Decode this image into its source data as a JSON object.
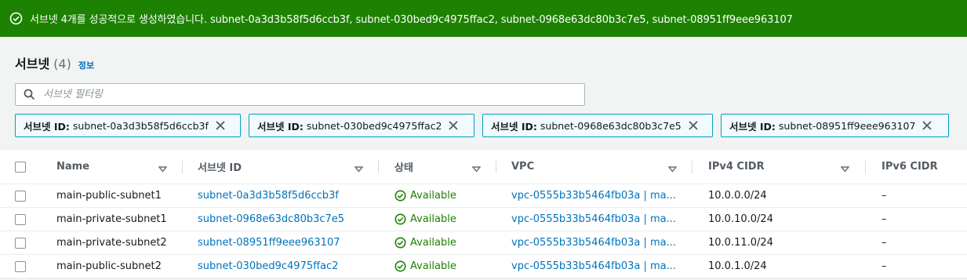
{
  "flash": {
    "message": "서브넷 4개를 성공적으로 생성하였습니다. subnet-0a3d3b58f5d6ccb3f, subnet-030bed9c4975ffac2, subnet-0968e63dc80b3c7e5, subnet-08951ff9eee963107",
    "color": "#1d8102"
  },
  "header": {
    "title": "서브넷",
    "count": "(4)",
    "info": "정보"
  },
  "search": {
    "placeholder": "서브넷 필터링"
  },
  "tokens": [
    {
      "key": "서브넷 ID:",
      "value": "subnet-0a3d3b58f5d6ccb3f"
    },
    {
      "key": "서브넷 ID:",
      "value": "subnet-030bed9c4975ffac2"
    },
    {
      "key": "서브넷 ID:",
      "value": "subnet-0968e63dc80b3c7e5"
    },
    {
      "key": "서브넷 ID:",
      "value": "subnet-08951ff9eee963107"
    }
  ],
  "table": {
    "headers": {
      "name": "Name",
      "id": "서브넷 ID",
      "state": "상태",
      "vpc": "VPC",
      "ipv4": "IPv4 CIDR",
      "ipv6": "IPv6 CIDR"
    },
    "rows": [
      {
        "name": "main-public-subnet1",
        "id": "subnet-0a3d3b58f5d6ccb3f",
        "state": "Available",
        "vpc": "vpc-0555b33b5464fb03a | ma...",
        "ipv4": "10.0.0.0/24",
        "ipv6": "–"
      },
      {
        "name": "main-private-subnet1",
        "id": "subnet-0968e63dc80b3c7e5",
        "state": "Available",
        "vpc": "vpc-0555b33b5464fb03a | ma...",
        "ipv4": "10.0.10.0/24",
        "ipv6": "–"
      },
      {
        "name": "main-private-subnet2",
        "id": "subnet-08951ff9eee963107",
        "state": "Available",
        "vpc": "vpc-0555b33b5464fb03a | ma...",
        "ipv4": "10.0.11.0/24",
        "ipv6": "–"
      },
      {
        "name": "main-public-subnet2",
        "id": "subnet-030bed9c4975ffac2",
        "state": "Available",
        "vpc": "vpc-0555b33b5464fb03a | ma...",
        "ipv4": "10.0.1.0/24",
        "ipv6": "–"
      }
    ]
  },
  "colors": {
    "link": "#0073bb",
    "success": "#1d8102",
    "token_border": "#00a1c9"
  },
  "icons": {
    "flash": "check-circle-icon",
    "search": "search-icon",
    "token_remove": "close-icon",
    "sort": "caret-down-icon",
    "status": "check-circle-icon"
  }
}
